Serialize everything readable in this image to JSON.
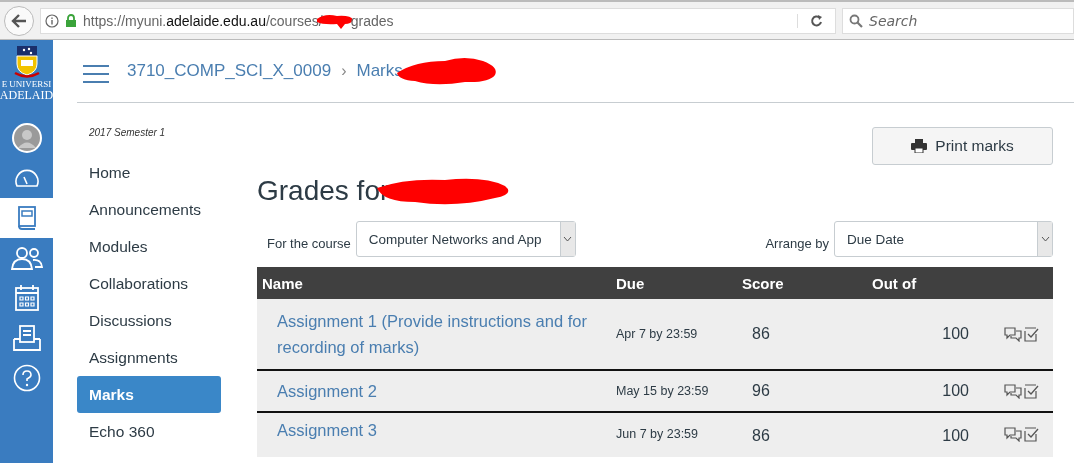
{
  "browser": {
    "url": {
      "prefix": "https://myuni.",
      "domain": "adelaide.edu.au",
      "path": "/courses/",
      "suffix": "grades",
      "redacted": true
    },
    "search": {
      "placeholder": "Search"
    }
  },
  "logo": {
    "lines": [
      "E UNIVERSI",
      "ADELAID"
    ]
  },
  "global_nav": [
    {
      "kind": "account",
      "selected": false
    },
    {
      "kind": "dashboard",
      "selected": false
    },
    {
      "kind": "courses",
      "selected": true
    },
    {
      "kind": "groups",
      "selected": false
    },
    {
      "kind": "calendar",
      "selected": false
    },
    {
      "kind": "inbox",
      "selected": false
    },
    {
      "kind": "help",
      "selected": false
    }
  ],
  "breadcrumb": {
    "course": "3710_COMP_SCI_X_0009",
    "separator": "›",
    "page": "Marks",
    "redacted": true
  },
  "course_nav": {
    "term": "2017 Semester 1",
    "items": [
      {
        "label": "Home",
        "selected": false
      },
      {
        "label": "Announcements",
        "selected": false
      },
      {
        "label": "Modules",
        "selected": false
      },
      {
        "label": "Collaborations",
        "selected": false
      },
      {
        "label": "Discussions",
        "selected": false
      },
      {
        "label": "Assignments",
        "selected": false
      },
      {
        "label": "Marks",
        "selected": true
      },
      {
        "label": "Echo 360",
        "selected": false
      }
    ]
  },
  "print_button": "Print marks",
  "title": {
    "text": "Grades for",
    "redacted": true
  },
  "filters": {
    "course": {
      "label": "For the course",
      "value": "Computer Networks and App"
    },
    "arrange": {
      "label": "Arrange by",
      "value": "Due Date"
    }
  },
  "table": {
    "columns": [
      "Name",
      "Due",
      "Score",
      "Out of"
    ],
    "rows": [
      {
        "name": "Assignment 1 (Provide instructions and for recording of marks)",
        "due": "Apr 7 by 23:59",
        "score": "86",
        "out_of": "100"
      },
      {
        "name": "Assignment 2",
        "due": "May 15 by 23:59",
        "score": "96",
        "out_of": "100"
      },
      {
        "name": "Assignment 3",
        "due": "Jun 7 by 23:59",
        "score": "86",
        "out_of": "100"
      }
    ]
  }
}
